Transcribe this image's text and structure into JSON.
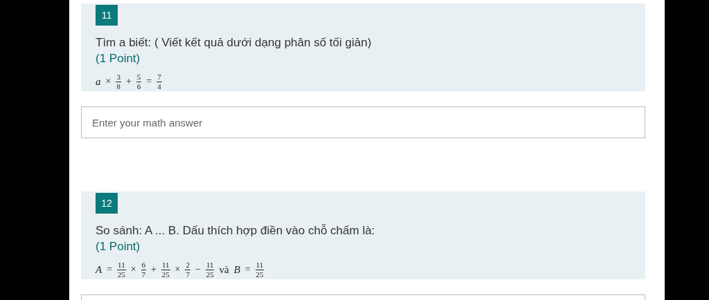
{
  "questions": [
    {
      "number": "11",
      "title": "Tìm a biết: ( Viết kết quả dưới dạng phân số tối giản)",
      "points": "(1 Point)",
      "formula": [
        {
          "kind": "var",
          "text": "a"
        },
        {
          "kind": "op",
          "text": "×"
        },
        {
          "kind": "frac",
          "num": "3",
          "den": "8"
        },
        {
          "kind": "op",
          "text": "+"
        },
        {
          "kind": "frac",
          "num": "5",
          "den": "6"
        },
        {
          "kind": "op",
          "text": "="
        },
        {
          "kind": "frac",
          "num": "7",
          "den": "4"
        }
      ],
      "answer_field": true,
      "placeholder": "Enter your math answer"
    },
    {
      "number": "12",
      "title": "So sánh: A ... B. Dấu thích hợp điền vào chỗ chấm là:",
      "points": "(1 Point)",
      "formula": [
        {
          "kind": "var",
          "text": "A"
        },
        {
          "kind": "op",
          "text": "="
        },
        {
          "kind": "frac",
          "num": "11",
          "den": "25"
        },
        {
          "kind": "op",
          "text": "×"
        },
        {
          "kind": "frac",
          "num": "6",
          "den": "7"
        },
        {
          "kind": "op",
          "text": "+"
        },
        {
          "kind": "frac",
          "num": "11",
          "den": "25"
        },
        {
          "kind": "op",
          "text": "×"
        },
        {
          "kind": "frac",
          "num": "2",
          "den": "7"
        },
        {
          "kind": "op",
          "text": "−"
        },
        {
          "kind": "frac",
          "num": "11",
          "den": "25"
        },
        {
          "kind": "word",
          "text": "và"
        },
        {
          "kind": "var",
          "text": "B"
        },
        {
          "kind": "op",
          "text": "="
        },
        {
          "kind": "frac",
          "num": "11",
          "den": "25"
        }
      ],
      "answer_field": true
    }
  ]
}
